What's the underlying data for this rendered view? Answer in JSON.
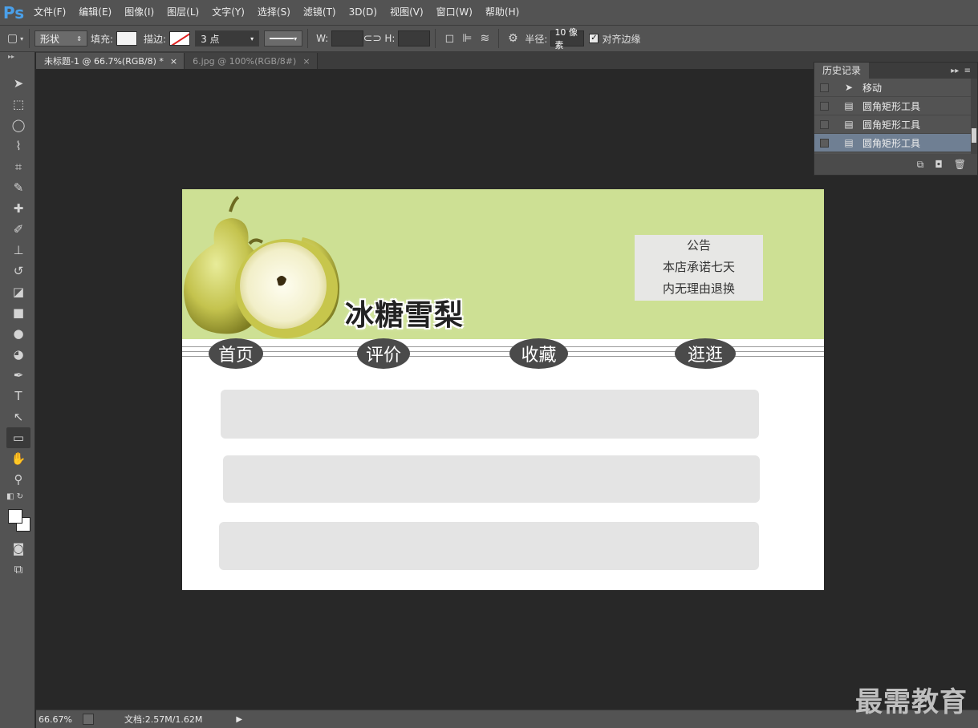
{
  "app": {
    "logo": "Ps"
  },
  "menu": [
    "文件(F)",
    "编辑(E)",
    "图像(I)",
    "图层(L)",
    "文字(Y)",
    "选择(S)",
    "滤镜(T)",
    "3D(D)",
    "视图(V)",
    "窗口(W)",
    "帮助(H)"
  ],
  "options": {
    "mode": "形状",
    "fill_label": "填充:",
    "stroke_label": "描边:",
    "stroke_width": "3 点",
    "w_label": "W:",
    "h_label": "H:",
    "radius_label": "半径:",
    "radius_value": "10 像素",
    "align_edges_label": "对齐边缘",
    "align_edges_checked": true
  },
  "tabs": [
    {
      "label": "未标题-1 @ 66.7%(RGB/8) *",
      "active": true
    },
    {
      "label": "6.jpg @ 100%(RGB/8#)",
      "active": false
    }
  ],
  "document": {
    "title": "冰糖雪梨",
    "header_color": "#cde094",
    "notice": {
      "line1": "公告",
      "line2": "本店承诺七天",
      "line3": "内无理由退换"
    },
    "nav": [
      "首页",
      "评价",
      "收藏",
      "逛逛"
    ],
    "blocks": 3
  },
  "history": {
    "panel_title": "历史记录",
    "items": [
      {
        "label": "移动",
        "icon": "move-icon"
      },
      {
        "label": "圆角矩形工具",
        "icon": "document-icon"
      },
      {
        "label": "圆角矩形工具",
        "icon": "document-icon"
      },
      {
        "label": "圆角矩形工具",
        "icon": "document-icon",
        "selected": true
      }
    ]
  },
  "status": {
    "zoom": "66.67%",
    "doc_info": "文档:2.57M/1.62M"
  },
  "watermark": "最需教育"
}
